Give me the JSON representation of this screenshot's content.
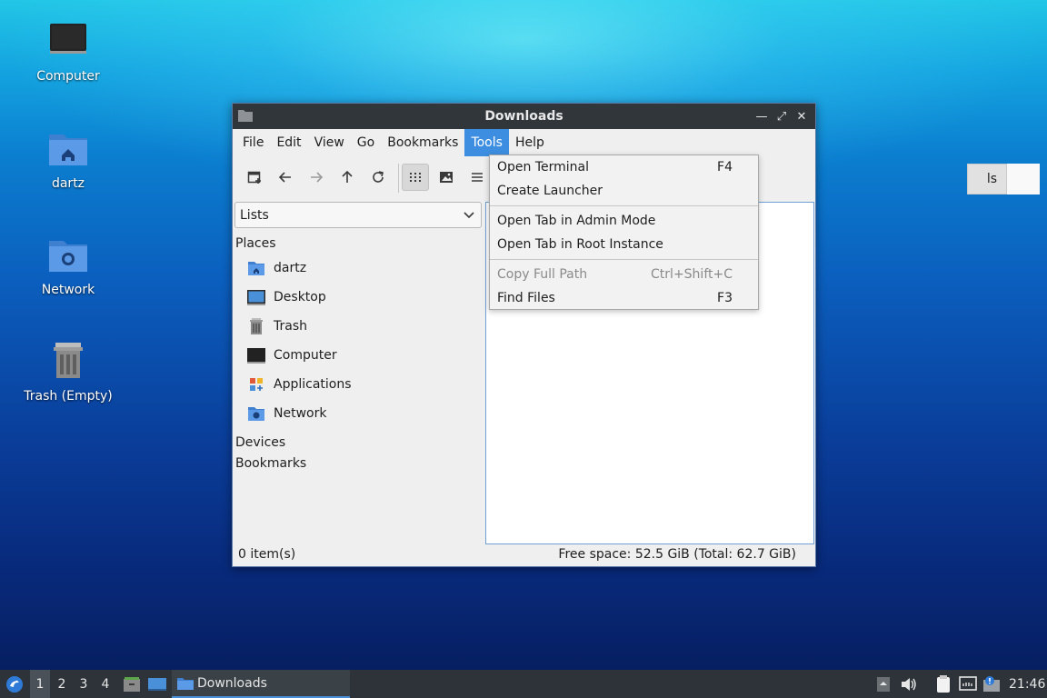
{
  "desktop": {
    "icons": [
      {
        "label": "Computer"
      },
      {
        "label": "dartz"
      },
      {
        "label": "Network"
      },
      {
        "label": "Trash (Empty)"
      }
    ]
  },
  "window": {
    "title": "Downloads",
    "menu": [
      "File",
      "Edit",
      "View",
      "Go",
      "Bookmarks",
      "Tools",
      "Help"
    ],
    "active_menu": "Tools",
    "path_fragment": "ls",
    "side_pane_mode": "Lists",
    "sidebar": {
      "places_header": "Places",
      "places": [
        "dartz",
        "Desktop",
        "Trash",
        "Computer",
        "Applications",
        "Network"
      ],
      "devices_header": "Devices",
      "bookmarks_header": "Bookmarks"
    },
    "status": {
      "items": "0 item(s)",
      "free_space": "Free space: 52.5 GiB (Total: 62.7 GiB)"
    }
  },
  "tools_menu": [
    {
      "label": "Open Terminal",
      "shortcut": "F4",
      "enabled": true
    },
    {
      "label": "Create Launcher",
      "shortcut": "",
      "enabled": true
    },
    {
      "label": "Open Tab in Admin Mode",
      "shortcut": "",
      "enabled": true
    },
    {
      "label": "Open Tab in Root Instance",
      "shortcut": "",
      "enabled": true
    },
    {
      "label": "Copy Full Path",
      "shortcut": "Ctrl+Shift+C",
      "enabled": false
    },
    {
      "label": "Find Files",
      "shortcut": "F3",
      "enabled": true
    }
  ],
  "taskbar": {
    "workspaces": [
      "1",
      "2",
      "3",
      "4"
    ],
    "current_workspace": "1",
    "task_label": "Downloads",
    "clock": "21:46"
  },
  "colors": {
    "accent": "#3d8ee0",
    "titlebar": "#31363b",
    "taskbar": "#2d3338",
    "folder_blue": "#4a90d9"
  }
}
